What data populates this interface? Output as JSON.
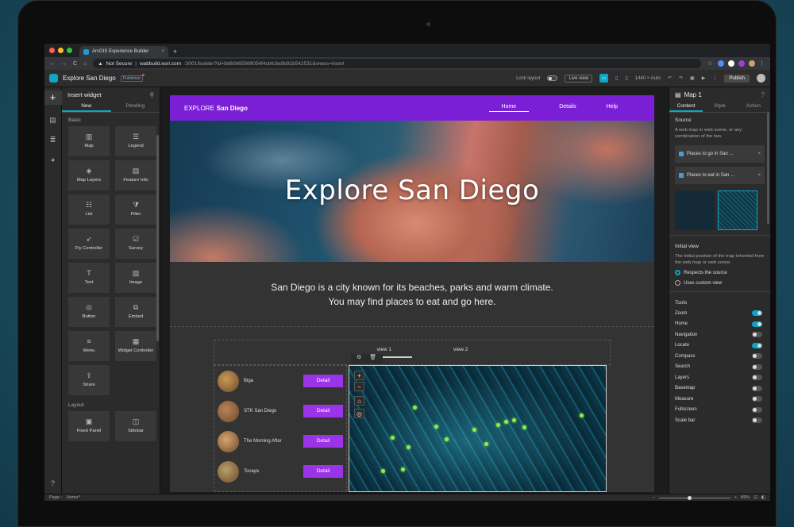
{
  "browser": {
    "tab_title": "ArcGIS Experience Builder",
    "not_secure": "Not Secure",
    "url_host": "wabbuild.esri.com",
    "url_rest": ":3001/builder?id=9d60b65999054f4cbfc9a9b91b542531&views=insert"
  },
  "header": {
    "app_title": "Explore San Diego",
    "badge": "Published",
    "lock_layout": "Lock layout",
    "live_view": "Live view",
    "size": "1440 × Auto",
    "publish": "Publish"
  },
  "insert_panel": {
    "title": "Insert widget",
    "tabs": [
      "New",
      "Pending"
    ],
    "basic_label": "Basic",
    "widgets": [
      {
        "label": "Map",
        "icon": "map-icon"
      },
      {
        "label": "Legend",
        "icon": "legend-icon"
      },
      {
        "label": "Map Layers",
        "icon": "layers-icon"
      },
      {
        "label": "Feature Info",
        "icon": "feature-info-icon"
      },
      {
        "label": "List",
        "icon": "list-icon"
      },
      {
        "label": "Filter",
        "icon": "filter-icon"
      },
      {
        "label": "Fly Controller",
        "icon": "fly-icon"
      },
      {
        "label": "Survey",
        "icon": "survey-icon"
      },
      {
        "label": "Text",
        "icon": "text-icon"
      },
      {
        "label": "Image",
        "icon": "image-icon"
      },
      {
        "label": "Button",
        "icon": "button-icon"
      },
      {
        "label": "Embed",
        "icon": "embed-icon"
      },
      {
        "label": "Menu",
        "icon": "menu-icon"
      },
      {
        "label": "Widget Controller",
        "icon": "widget-controller-icon"
      },
      {
        "label": "Share",
        "icon": "share-icon"
      }
    ],
    "layout_label": "Layout",
    "layout_widgets": [
      {
        "label": "Fixed Panel",
        "icon": "fixed-panel-icon"
      },
      {
        "label": "Sidebar",
        "icon": "sidebar-icon"
      }
    ]
  },
  "site": {
    "brand_a": "EXPLORE",
    "brand_b": "San Diego",
    "nav": [
      "Home",
      "Details",
      "Help"
    ],
    "hero_title": "Explore San Diego",
    "intro_line1": "San Diego is a city known for its beaches, parks and warm climate.",
    "intro_line2": "You may find places to eat and go here.",
    "views": [
      "view 1",
      "view 2"
    ],
    "places": [
      {
        "name": "Biga",
        "button": "Detail"
      },
      {
        "name": "STK San Diego",
        "button": "Detail"
      },
      {
        "name": "The Morning After",
        "button": "Detail"
      },
      {
        "name": "Tocaya",
        "button": "Detail"
      }
    ]
  },
  "settings": {
    "title": "Map 1",
    "tabs": [
      "Content",
      "Style",
      "Action"
    ],
    "source_label": "Source",
    "source_desc": "A web map or web scene, or any combination of the two.",
    "sources": [
      "Places to go in San ...",
      "Places to eat in San ..."
    ],
    "initial_view": "Initial view",
    "initial_desc": "The initial position of the map inherited from the web map or web scene.",
    "respects": "Respects the source",
    "custom": "Uses custom view",
    "tools_label": "Tools",
    "tools": [
      {
        "name": "Zoom",
        "on": true
      },
      {
        "name": "Home",
        "on": true
      },
      {
        "name": "Navigation",
        "on": false
      },
      {
        "name": "Locate",
        "on": true
      },
      {
        "name": "Compass",
        "on": false
      },
      {
        "name": "Search",
        "on": false
      },
      {
        "name": "Layers",
        "on": false
      },
      {
        "name": "Basemap",
        "on": false
      },
      {
        "name": "Measure",
        "on": false
      },
      {
        "name": "Fullscreen",
        "on": false
      },
      {
        "name": "Scale bar",
        "on": false
      }
    ]
  },
  "status": {
    "page": "Page :",
    "home": "Home^",
    "zoom": "89%"
  }
}
